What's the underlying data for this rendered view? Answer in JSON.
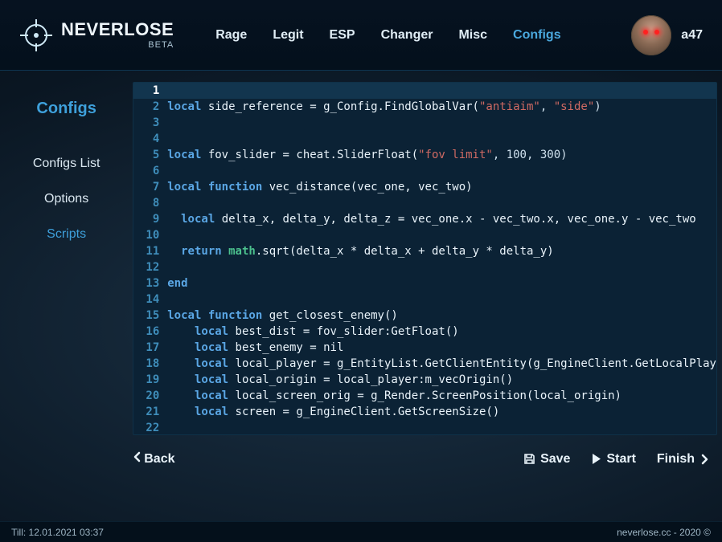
{
  "brand": {
    "name": "NEVERLOSE",
    "sub": "BETA"
  },
  "nav": {
    "items": [
      {
        "label": "Rage"
      },
      {
        "label": "Legit"
      },
      {
        "label": "ESP"
      },
      {
        "label": "Changer"
      },
      {
        "label": "Misc"
      },
      {
        "label": "Configs"
      }
    ],
    "active_index": 5
  },
  "user": {
    "name": "a47"
  },
  "sidebar": {
    "title": "Configs",
    "items": [
      {
        "label": "Configs List"
      },
      {
        "label": "Options"
      },
      {
        "label": "Scripts"
      }
    ],
    "active_index": 2
  },
  "editor": {
    "selected_line": 1,
    "lines": [
      {
        "n": 1,
        "t": []
      },
      {
        "n": 2,
        "t": [
          {
            "c": "kw",
            "s": "local "
          },
          {
            "c": "fn",
            "s": "side_reference = g_Config.FindGlobalVar("
          },
          {
            "c": "str",
            "s": "\"antiaim\""
          },
          {
            "c": "punc",
            "s": ", "
          },
          {
            "c": "str",
            "s": "\"side\""
          },
          {
            "c": "punc",
            "s": ")"
          }
        ]
      },
      {
        "n": 3,
        "t": []
      },
      {
        "n": 4,
        "t": []
      },
      {
        "n": 5,
        "t": [
          {
            "c": "kw",
            "s": "local "
          },
          {
            "c": "fn",
            "s": "fov_slider = cheat.SliderFloat("
          },
          {
            "c": "str",
            "s": "\"fov limit\""
          },
          {
            "c": "punc",
            "s": ", 100, 300)"
          }
        ]
      },
      {
        "n": 6,
        "t": []
      },
      {
        "n": 7,
        "t": [
          {
            "c": "kw",
            "s": "local function "
          },
          {
            "c": "fn",
            "s": "vec_distance(vec_one, vec_two)"
          }
        ]
      },
      {
        "n": 8,
        "t": []
      },
      {
        "n": 9,
        "t": [
          {
            "c": "",
            "s": "  "
          },
          {
            "c": "kw",
            "s": "local "
          },
          {
            "c": "fn",
            "s": "delta_x, delta_y, delta_z = vec_one.x - vec_two.x, vec_one.y - vec_two"
          }
        ]
      },
      {
        "n": 10,
        "t": []
      },
      {
        "n": 11,
        "t": [
          {
            "c": "",
            "s": "  "
          },
          {
            "c": "kw",
            "s": "return "
          },
          {
            "c": "lib",
            "s": "math"
          },
          {
            "c": "fn",
            "s": ".sqrt(delta_x * delta_x + delta_y * delta_y)"
          }
        ]
      },
      {
        "n": 12,
        "t": []
      },
      {
        "n": 13,
        "t": [
          {
            "c": "kw",
            "s": "end"
          }
        ]
      },
      {
        "n": 14,
        "t": []
      },
      {
        "n": 15,
        "t": [
          {
            "c": "kw",
            "s": "local function "
          },
          {
            "c": "fn",
            "s": "get_closest_enemy()"
          }
        ]
      },
      {
        "n": 16,
        "t": [
          {
            "c": "",
            "s": "    "
          },
          {
            "c": "kw",
            "s": "local "
          },
          {
            "c": "fn",
            "s": "best_dist = fov_slider:GetFloat()"
          }
        ]
      },
      {
        "n": 17,
        "t": [
          {
            "c": "",
            "s": "    "
          },
          {
            "c": "kw",
            "s": "local "
          },
          {
            "c": "fn",
            "s": "best_enemy = nil"
          }
        ]
      },
      {
        "n": 18,
        "t": [
          {
            "c": "",
            "s": "    "
          },
          {
            "c": "kw",
            "s": "local "
          },
          {
            "c": "fn",
            "s": "local_player = g_EntityList.GetClientEntity(g_EngineClient.GetLocalPlay"
          }
        ]
      },
      {
        "n": 19,
        "t": [
          {
            "c": "",
            "s": "    "
          },
          {
            "c": "kw",
            "s": "local "
          },
          {
            "c": "fn",
            "s": "local_origin = local_player:m_vecOrigin()"
          }
        ]
      },
      {
        "n": 20,
        "t": [
          {
            "c": "",
            "s": "    "
          },
          {
            "c": "kw",
            "s": "local "
          },
          {
            "c": "fn",
            "s": "local_screen_orig = g_Render.ScreenPosition(local_origin)"
          }
        ]
      },
      {
        "n": 21,
        "t": [
          {
            "c": "",
            "s": "    "
          },
          {
            "c": "kw",
            "s": "local "
          },
          {
            "c": "fn",
            "s": "screen = g_EngineClient.GetScreenSize()"
          }
        ]
      },
      {
        "n": 22,
        "t": []
      }
    ]
  },
  "actions": {
    "back": "Back",
    "save": "Save",
    "start": "Start",
    "finish": "Finish"
  },
  "footer": {
    "left": "Till: 12.01.2021 03:37",
    "right": "neverlose.cc - 2020 ©"
  }
}
